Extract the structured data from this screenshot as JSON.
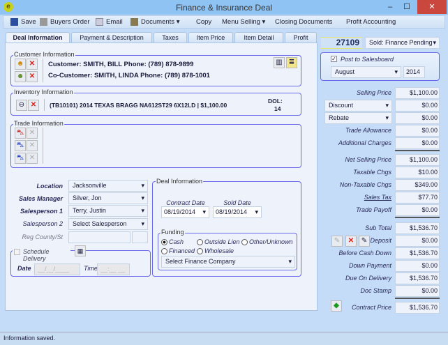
{
  "window": {
    "title": "Finance & Insurance Deal",
    "app_icon": "e",
    "minimize": "–",
    "maximize": "☐",
    "close": "✕"
  },
  "toolbar": {
    "save": "Save",
    "buyers_order": "Buyers Order",
    "email": "Email",
    "documents": "Documents",
    "copy": "Copy",
    "menu_selling": "Menu Selling",
    "closing_documents": "Closing Documents",
    "profit_accounting": "Profit Accounting"
  },
  "tabs": [
    "Deal Information",
    "Payment & Description",
    "Taxes",
    "Item Price",
    "Item Detail",
    "Profit"
  ],
  "deal_number": "27109",
  "deal_status": "Sold: Finance Pending",
  "salesboard": {
    "label": "Post to Salesboard",
    "checked": true,
    "month": "August",
    "year": "2014"
  },
  "customer": {
    "group": "Customer Information",
    "customer": "Customer: SMITH, BILL   Phone: (789) 878-9899",
    "co_customer": "Co-Customer: SMITH, LINDA   Phone: (789) 878-1001"
  },
  "inventory": {
    "group": "Inventory Information",
    "item": "(TB10101)  2014 TEXAS BRAGG NA612ST29 6X12LD | $1,100.00",
    "dol_label": "DOL:",
    "dol": "14"
  },
  "trade": {
    "group": "Trade Information"
  },
  "assign": {
    "location_label": "Location",
    "location": "Jacksonville",
    "sales_manager_label": "Sales Manager",
    "sales_manager": "Silver, Jon",
    "sp1_label": "Salesperson 1",
    "sp1": "Terry, Justin",
    "sp2_label": "Salesperson 2",
    "sp2": "Select Salesperson",
    "reg_label": "Reg County/St"
  },
  "delivery": {
    "label": "Schedule Delivery",
    "date_label": "Date",
    "date_ph": "__/__/____",
    "time_label": "Time",
    "time_ph": "__:__ __"
  },
  "deal_info": {
    "group": "Deal Information",
    "contract_date_label": "Contract Date",
    "contract_date": "08/19/2014",
    "sold_date_label": "Sold Date",
    "sold_date": "08/19/2014"
  },
  "funding": {
    "group": "Funding",
    "options": [
      "Cash",
      "Outside Lien",
      "Other/Unknown",
      "Financed",
      "Wholesale"
    ],
    "selected": "Cash",
    "finance_company": "Select Finance Company"
  },
  "pricing": {
    "selling_price": {
      "label": "Selling Price",
      "value": "$1,100.00"
    },
    "discount": {
      "label": "Discount",
      "value": "$0.00"
    },
    "rebate": {
      "label": "Rebate",
      "value": "$0.00"
    },
    "trade_allowance": {
      "label": "Trade Allowance",
      "value": "$0.00"
    },
    "additional_charges": {
      "label": "Additional Charges",
      "value": "$0.00"
    },
    "net_selling_price": {
      "label": "Net Selling Price",
      "value": "$1,100.00"
    },
    "taxable_chgs": {
      "label": "Taxable Chgs",
      "value": "$10.00"
    },
    "non_taxable_chgs": {
      "label": "Non-Taxable Chgs",
      "value": "$349.00"
    },
    "sales_tax": {
      "label": "Sales Tax",
      "value": "$77.70"
    },
    "trade_payoff": {
      "label": "Trade Payoff",
      "value": "$0.00"
    },
    "sub_total": {
      "label": "Sub Total",
      "value": "$1,536.70"
    },
    "deposit": {
      "label": "Deposit",
      "value": "$0.00"
    },
    "before_cash_down": {
      "label": "Before Cash Down",
      "value": "$1,536.70"
    },
    "down_payment": {
      "label": "Down Payment",
      "value": "$0.00"
    },
    "due_on_delivery": {
      "label": "Due On Delivery",
      "value": "$1,536.70"
    },
    "doc_stamp": {
      "label": "Doc Stamp",
      "value": "$0.00"
    },
    "contract_price": {
      "label": "Contract Price",
      "value": "$1,536.70"
    }
  },
  "status": "Information saved."
}
